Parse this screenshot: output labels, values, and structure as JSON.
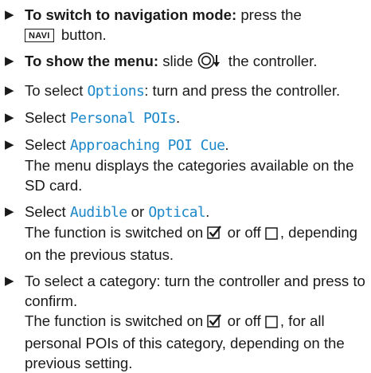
{
  "marker": "▶",
  "steps": [
    {
      "bold": "To switch to navigation mode:",
      "text1": " press the",
      "key": "NAVI",
      "text2": " button."
    },
    {
      "bold": "To show the menu:",
      "text1": " slide ",
      "text2": " the controller."
    },
    {
      "text1": "To select ",
      "menu": "Options",
      "text2": ": turn and press the controller."
    },
    {
      "text1": "Select ",
      "menu": "Personal POIs",
      "text2": "."
    },
    {
      "text1": "Select ",
      "menu": "Approaching POI Cue",
      "text2": ".",
      "line2": "The menu displays the categories available on the SD card."
    },
    {
      "text1": "Select ",
      "menu1": "Audible",
      "or": " or ",
      "menu2": "Optical",
      "text2": ".",
      "line2a": "The function is switched on ",
      "line2b": " or off ",
      "line2c": ", depending on the previous status."
    },
    {
      "text1": "To select a category: turn the controller and press to confirm.",
      "line2a": "The function is switched on ",
      "line2b": " or off ",
      "line2c": ", for all personal POIs of this category, depending on the previous setting."
    }
  ],
  "icons": {
    "controller": "controller-slide-down-icon",
    "checked": "checkbox-checked-icon",
    "unchecked": "checkbox-unchecked-icon"
  },
  "colors": {
    "menu_text": "#1c87c9"
  }
}
